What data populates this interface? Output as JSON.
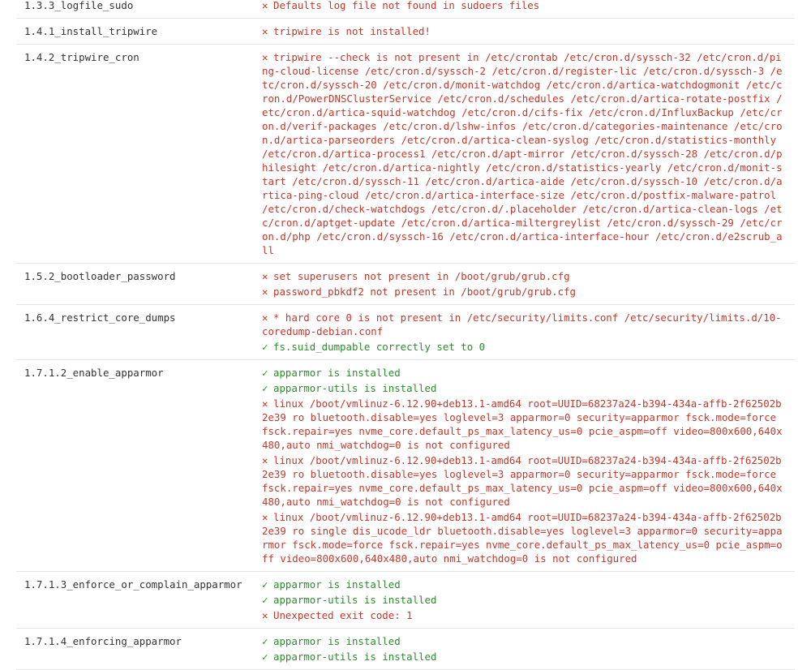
{
  "colors": {
    "pass": "#2e8b2e",
    "fail": "#c0392b",
    "row_border": "#e6e6e6"
  },
  "icons": {
    "pass": "check-icon",
    "fail": "cross-icon"
  },
  "rows": [
    {
      "id": "1.3.3_logfile_sudo",
      "messages": [
        {
          "status": "fail",
          "text": "Defaults log file not found in sudoers files"
        }
      ]
    },
    {
      "id": "1.4.1_install_tripwire",
      "messages": [
        {
          "status": "fail",
          "text": "tripwire is not installed!"
        }
      ]
    },
    {
      "id": "1.4.2_tripwire_cron",
      "messages": [
        {
          "status": "fail",
          "text": "tripwire --check is not present in /etc/crontab /etc/cron.d/syssch-32 /etc/cron.d/ping-cloud-license /etc/cron.d/syssch-2 /etc/cron.d/register-lic /etc/cron.d/syssch-3 /etc/cron.d/syssch-20 /etc/cron.d/monit-watchdog /etc/cron.d/artica-watchdogmonit /etc/cron.d/PowerDNSClusterService /etc/cron.d/schedules /etc/cron.d/artica-rotate-postfix /etc/cron.d/artica-squid-watchdog /etc/cron.d/cifs-fix /etc/cron.d/InfluxBackup /etc/cron.d/verif-packages /etc/cron.d/lshw-infos /etc/cron.d/categories-maintenance /etc/cron.d/artica-parseorders /etc/cron.d/artica-clean-syslog /etc/cron.d/statistics-monthly /etc/cron.d/artica-process1 /etc/cron.d/apt-mirror /etc/cron.d/syssch-28 /etc/cron.d/philesight /etc/cron.d/artica-nightly /etc/cron.d/statistics-yearly /etc/cron.d/monit-start /etc/cron.d/syssch-11 /etc/cron.d/artica-aide /etc/cron.d/syssch-10 /etc/cron.d/artica-ping-cloud /etc/cron.d/artica-interface-size /etc/cron.d/postfix-malware-patrol /etc/cron.d/check-watchdogs /etc/cron.d/.placeholder /etc/cron.d/artica-clean-logs /etc/cron.d/aptget-update /etc/cron.d/artica-miltergreylist /etc/cron.d/syssch-29 /etc/cron.d/php /etc/cron.d/syssch-16 /etc/cron.d/artica-interface-hour /etc/cron.d/e2scrub_all"
        }
      ]
    },
    {
      "id": "1.5.2_bootloader_password",
      "messages": [
        {
          "status": "fail",
          "text": "set superusers not present in /boot/grub/grub.cfg"
        },
        {
          "status": "fail",
          "text": "password_pbkdf2 not present in /boot/grub/grub.cfg"
        }
      ]
    },
    {
      "id": "1.6.4_restrict_core_dumps",
      "messages": [
        {
          "status": "fail",
          "text": "* hard core 0 is not present in /etc/security/limits.conf /etc/security/limits.d/10-coredump-debian.conf"
        },
        {
          "status": "pass",
          "text": "fs.suid_dumpable correctly set to 0"
        }
      ]
    },
    {
      "id": "1.7.1.2_enable_apparmor",
      "messages": [
        {
          "status": "pass",
          "text": "apparmor is installed"
        },
        {
          "status": "pass",
          "text": "apparmor-utils is installed"
        },
        {
          "status": "fail",
          "text": "linux /boot/vmlinuz-6.12.90+deb13.1-amd64 root=UUID=68237a24-b394-434a-affb-2f62502b2e39 ro bluetooth.disable=yes loglevel=3 apparmor=0 security=apparmor fsck.mode=force fsck.repair=yes nvme_core.default_ps_max_latency_us=0 pcie_aspm=off video=800x600,640x480,auto nmi_watchdog=0 is not configured"
        },
        {
          "status": "fail",
          "text": "linux /boot/vmlinuz-6.12.90+deb13.1-amd64 root=UUID=68237a24-b394-434a-affb-2f62502b2e39 ro bluetooth.disable=yes loglevel=3 apparmor=0 security=apparmor fsck.mode=force fsck.repair=yes nvme_core.default_ps_max_latency_us=0 pcie_aspm=off video=800x600,640x480,auto nmi_watchdog=0 is not configured"
        },
        {
          "status": "fail",
          "text": "linux /boot/vmlinuz-6.12.90+deb13.1-amd64 root=UUID=68237a24-b394-434a-affb-2f62502b2e39 ro single dis_ucode_ldr bluetooth.disable=yes loglevel=3 apparmor=0 security=apparmor fsck.mode=force fsck.repair=yes nvme_core.default_ps_max_latency_us=0 pcie_aspm=off video=800x600,640x480,auto nmi_watchdog=0 is not configured"
        }
      ]
    },
    {
      "id": "1.7.1.3_enforce_or_complain_apparmor",
      "messages": [
        {
          "status": "pass",
          "text": "apparmor is installed"
        },
        {
          "status": "pass",
          "text": "apparmor-utils is installed"
        },
        {
          "status": "fail",
          "text": "Unexpected exit code: 1"
        }
      ]
    },
    {
      "id": "1.7.1.4_enforcing_apparmor",
      "messages": [
        {
          "status": "pass",
          "text": "apparmor is installed"
        },
        {
          "status": "pass",
          "text": "apparmor-utils is installed"
        }
      ]
    }
  ]
}
